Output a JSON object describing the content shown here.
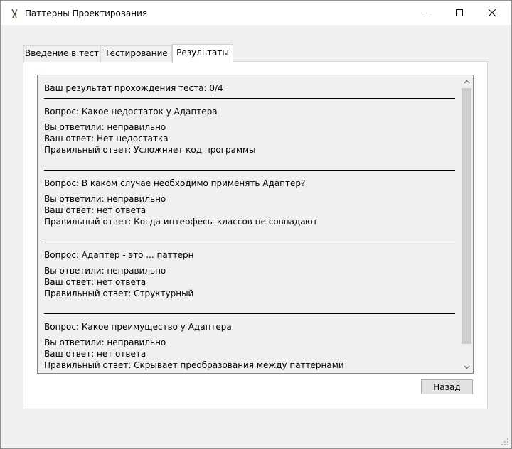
{
  "window": {
    "title": "Паттерны Проектирования",
    "icon": "tongs-app-icon"
  },
  "tabs": [
    {
      "label": "Введение в тест",
      "active": false
    },
    {
      "label": "Тестирование",
      "active": false
    },
    {
      "label": "Результаты",
      "active": true
    }
  ],
  "results": {
    "score_line": "Ваш результат прохождения теста: 0/4",
    "items": [
      {
        "question": "Вопрос: Какое недостаток у Адаптера",
        "status": "Вы ответили: неправильно",
        "your_answer": "Ваш ответ: Нет недостатка",
        "correct_answer": "Правильный ответ: Усложняет код программы"
      },
      {
        "question": "Вопрос: В каком случае необходимо применять Адаптер?",
        "status": "Вы ответили: неправильно",
        "your_answer": "Ваш ответ: нет ответа",
        "correct_answer": "Правильный ответ: Когда интерфесы классов не совпадают"
      },
      {
        "question": "Вопрос: Адаптер  - это ... паттерн",
        "status": "Вы ответили: неправильно",
        "your_answer": "Ваш ответ: нет ответа",
        "correct_answer": "Правильный ответ: Структурный"
      },
      {
        "question": "Вопрос: Какое преимущество у Адаптера",
        "status": "Вы ответили: неправильно",
        "your_answer": "Ваш ответ: нет ответа",
        "correct_answer": "Правильный ответ: Скрывает преобразования между паттернами"
      }
    ]
  },
  "footer": {
    "back_label": "Назад"
  }
}
